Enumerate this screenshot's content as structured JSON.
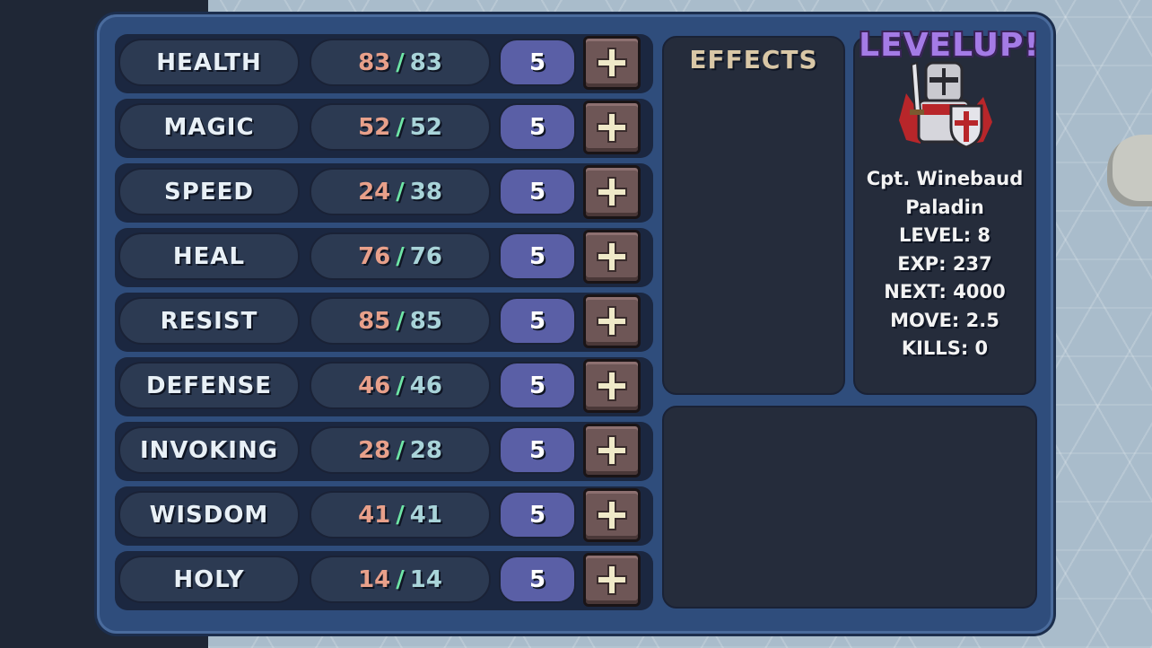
{
  "stats": [
    {
      "label": "HEALTH",
      "current": "83",
      "max": "83",
      "cost": "5"
    },
    {
      "label": "MAGIC",
      "current": "52",
      "max": "52",
      "cost": "5"
    },
    {
      "label": "SPEED",
      "current": "24",
      "max": "38",
      "cost": "5"
    },
    {
      "label": "HEAL",
      "current": "76",
      "max": "76",
      "cost": "5"
    },
    {
      "label": "RESIST",
      "current": "85",
      "max": "85",
      "cost": "5"
    },
    {
      "label": "DEFENSE",
      "current": "46",
      "max": "46",
      "cost": "5"
    },
    {
      "label": "INVOKING",
      "current": "28",
      "max": "28",
      "cost": "5"
    },
    {
      "label": "WISDOM",
      "current": "41",
      "max": "41",
      "cost": "5"
    },
    {
      "label": "HOLY",
      "current": "14",
      "max": "14",
      "cost": "5"
    }
  ],
  "separator": "/",
  "effects": {
    "title": "EFFECTS"
  },
  "levelup": "LEVELUP!",
  "character": {
    "name": "Cpt. Winebaud",
    "class": "Paladin",
    "level": "LEVEL: 8",
    "exp": "EXP: 237",
    "next": "NEXT: 4000",
    "move": "MOVE: 2.5",
    "kills": "KILLS: 0"
  },
  "icons": {
    "plus": "plus-icon",
    "portrait": "paladin-portrait-icon"
  },
  "colors": {
    "current": "#e8a08a",
    "slash": "#6ee6a6",
    "max": "#a9d4d9",
    "levelup": "#a47be6",
    "panel": "#2f4d7c"
  }
}
